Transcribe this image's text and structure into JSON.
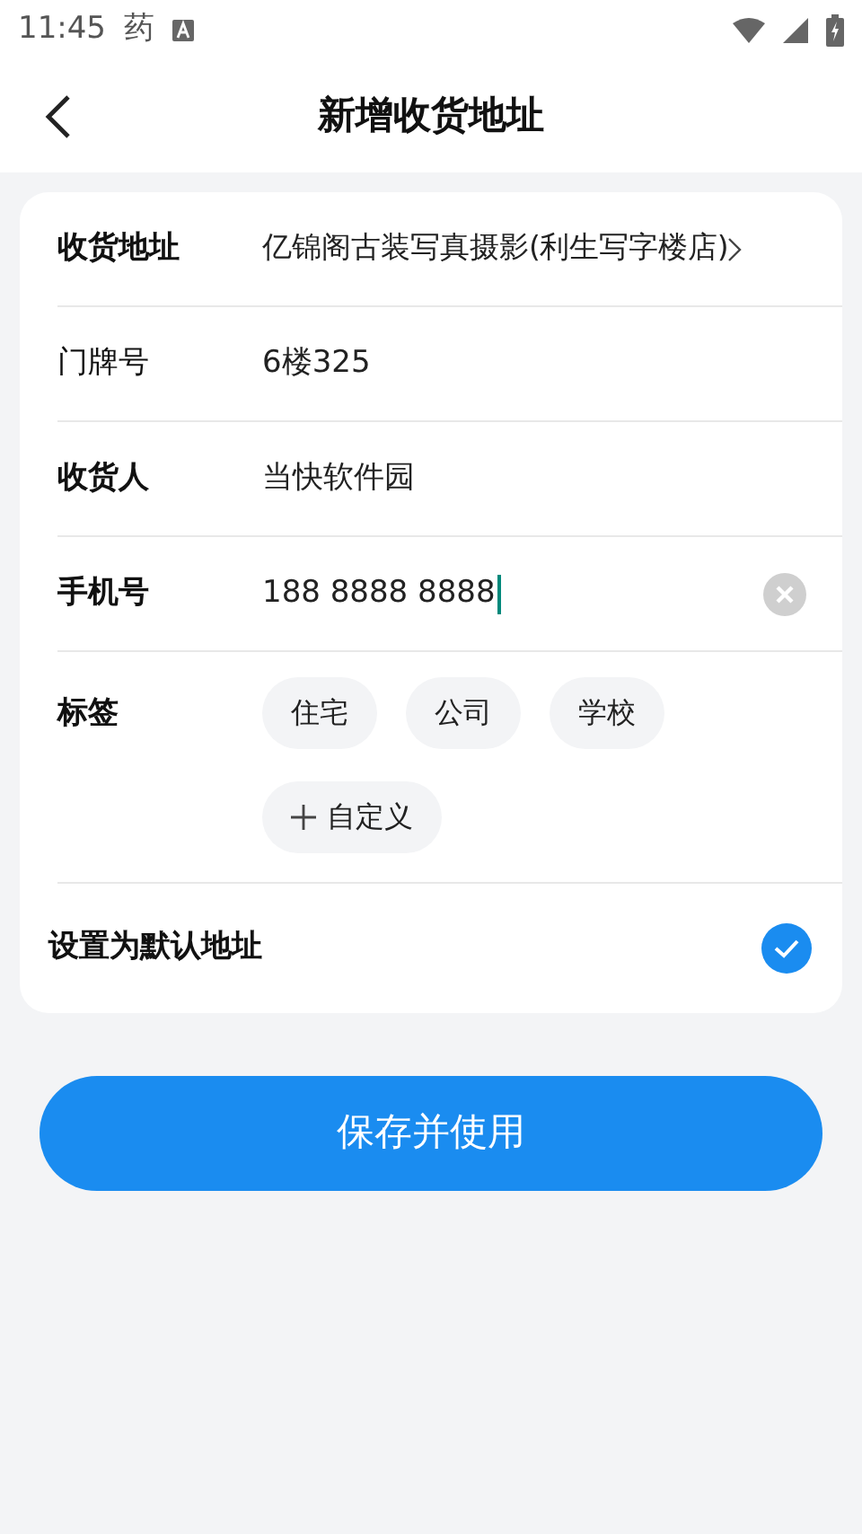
{
  "status_bar": {
    "time": "11:45",
    "notification": "药"
  },
  "header": {
    "title": "新增收货地址"
  },
  "fields": [
    {
      "kind": "link",
      "label": "收货地址",
      "value": "亿锦阁古装写真摄影(利生写字楼店)",
      "bold": true
    },
    {
      "kind": "text",
      "label": "门牌号",
      "value": "6楼325",
      "bold": false
    },
    {
      "kind": "text",
      "label": "收货人",
      "value": "当快软件园",
      "bold": true
    },
    {
      "kind": "clearable",
      "label": "手机号",
      "value": "188 8888 8888",
      "bold": true,
      "focused": true
    }
  ],
  "tags": {
    "label": "标签",
    "items": [
      {
        "kind": "tag",
        "label": "住宅",
        "selected": false
      },
      {
        "kind": "tag",
        "label": "公司",
        "selected": false
      },
      {
        "kind": "tag",
        "label": "学校",
        "selected": false
      },
      {
        "kind": "add",
        "label": "自定义",
        "selected": false
      }
    ]
  },
  "default_address": {
    "label": "设置为默认地址",
    "checked": true
  },
  "save_button": "保存并使用"
}
